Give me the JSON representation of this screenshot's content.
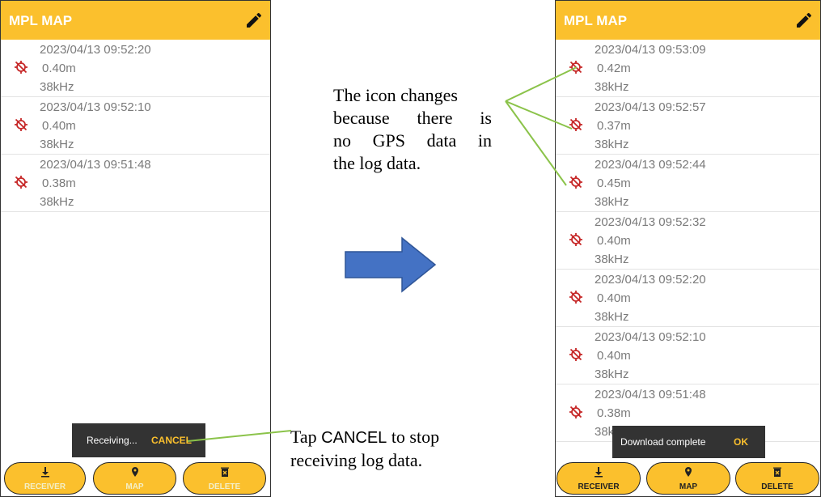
{
  "left_screen": {
    "app_title": "MPL MAP",
    "logs": [
      {
        "time": "2023/04/13 09:52:20",
        "depth": "0.40m",
        "freq": "38kHz"
      },
      {
        "time": "2023/04/13 09:52:10",
        "depth": "0.40m",
        "freq": "38kHz"
      },
      {
        "time": "2023/04/13 09:51:48",
        "depth": "0.38m",
        "freq": "38kHz"
      }
    ],
    "snackbar": {
      "text": "Receiving...",
      "action": "CANCEL"
    },
    "buttons": {
      "receiver": "RECEIVER",
      "map": "MAP",
      "delete": "DELETE"
    }
  },
  "right_screen": {
    "app_title": "MPL MAP",
    "logs": [
      {
        "time": "2023/04/13 09:53:09",
        "depth": "0.42m",
        "freq": "38kHz"
      },
      {
        "time": "2023/04/13 09:52:57",
        "depth": "0.37m",
        "freq": "38kHz"
      },
      {
        "time": "2023/04/13 09:52:44",
        "depth": "0.45m",
        "freq": "38kHz"
      },
      {
        "time": "2023/04/13 09:52:32",
        "depth": "0.40m",
        "freq": "38kHz"
      },
      {
        "time": "2023/04/13 09:52:20",
        "depth": "0.40m",
        "freq": "38kHz"
      },
      {
        "time": "2023/04/13 09:52:10",
        "depth": "0.40m",
        "freq": "38kHz"
      },
      {
        "time": "2023/04/13 09:51:48",
        "depth": "0.38m",
        "freq": "38kHz"
      }
    ],
    "snackbar": {
      "text": "Download complete",
      "action": "OK"
    },
    "buttons": {
      "receiver": "RECEIVER",
      "map": "MAP",
      "delete": "DELETE"
    }
  },
  "annotations": {
    "icon_note_lines": [
      "The icon changes",
      "because there is",
      "no GPS data in",
      "the log data."
    ],
    "cancel_note": {
      "prefix": "Tap ",
      "keyword": "CANCEL",
      "suffix": " to stop",
      "line2": "receiving log data."
    }
  },
  "icons": {
    "edit": "pencil-icon",
    "log_row": "gps-off-icon",
    "receiver": "download-icon",
    "map": "map-pin-icon",
    "delete": "trash-icon",
    "arrow": "right-arrow"
  },
  "colors": {
    "app_bar": "#fbc02d",
    "gps_off_icon": "#c62828",
    "snackbar_bg": "#333333",
    "snackbar_action": "#fbc02d",
    "callout_line": "#8bc34a",
    "arrow_fill": "#4472c4"
  }
}
